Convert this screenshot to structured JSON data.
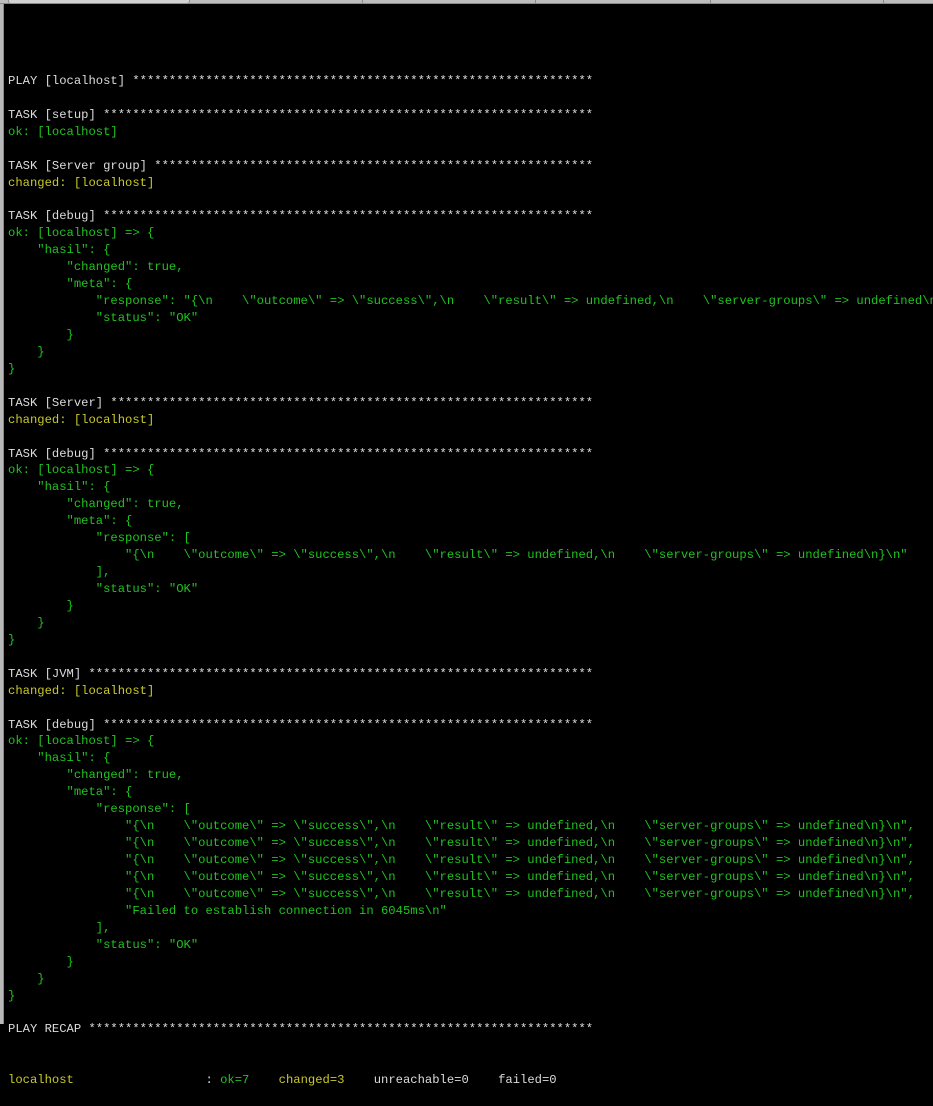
{
  "window": {
    "tabs": [
      {
        "label": "",
        "active": true
      },
      {
        "label": "",
        "active": false
      },
      {
        "label": "",
        "active": false
      },
      {
        "label": "",
        "active": false
      },
      {
        "label": "",
        "active": false
      }
    ]
  },
  "colors": {
    "background": "#000000",
    "header": "#dcdcdc",
    "ok": "#1fc41f",
    "changed": "#c9c92a"
  },
  "terminal": {
    "lines": [
      {
        "style": "white",
        "text": "PLAY [localhost] ***************************************************************"
      },
      {
        "style": "white",
        "text": ""
      },
      {
        "style": "white",
        "text": "TASK [setup] *******************************************************************"
      },
      {
        "style": "green",
        "text": "ok: [localhost]"
      },
      {
        "style": "white",
        "text": ""
      },
      {
        "style": "white",
        "text": "TASK [Server group] ************************************************************"
      },
      {
        "style": "yellow",
        "text": "changed: [localhost]"
      },
      {
        "style": "white",
        "text": ""
      },
      {
        "style": "white",
        "text": "TASK [debug] *******************************************************************"
      },
      {
        "style": "green",
        "text": "ok: [localhost] => {"
      },
      {
        "style": "green",
        "text": "    \"hasil\": {"
      },
      {
        "style": "green",
        "text": "        \"changed\": true,"
      },
      {
        "style": "green",
        "text": "        \"meta\": {"
      },
      {
        "style": "green",
        "text": "            \"response\": \"{\\n    \\\"outcome\\\" => \\\"success\\\",\\n    \\\"result\\\" => undefined,\\n    \\\"server-groups\\\" => undefined\\n}\\n\","
      },
      {
        "style": "green",
        "text": "            \"status\": \"OK\""
      },
      {
        "style": "green",
        "text": "        }"
      },
      {
        "style": "green",
        "text": "    }"
      },
      {
        "style": "green",
        "text": "}"
      },
      {
        "style": "white",
        "text": ""
      },
      {
        "style": "white",
        "text": "TASK [Server] ******************************************************************"
      },
      {
        "style": "yellow",
        "text": "changed: [localhost]"
      },
      {
        "style": "white",
        "text": ""
      },
      {
        "style": "white",
        "text": "TASK [debug] *******************************************************************"
      },
      {
        "style": "green",
        "text": "ok: [localhost] => {"
      },
      {
        "style": "green",
        "text": "    \"hasil\": {"
      },
      {
        "style": "green",
        "text": "        \"changed\": true,"
      },
      {
        "style": "green",
        "text": "        \"meta\": {"
      },
      {
        "style": "green",
        "text": "            \"response\": ["
      },
      {
        "style": "green",
        "text": "                \"{\\n    \\\"outcome\\\" => \\\"success\\\",\\n    \\\"result\\\" => undefined,\\n    \\\"server-groups\\\" => undefined\\n}\\n\""
      },
      {
        "style": "green",
        "text": "            ],"
      },
      {
        "style": "green",
        "text": "            \"status\": \"OK\""
      },
      {
        "style": "green",
        "text": "        }"
      },
      {
        "style": "green",
        "text": "    }"
      },
      {
        "style": "green",
        "text": "}"
      },
      {
        "style": "white",
        "text": ""
      },
      {
        "style": "white",
        "text": "TASK [JVM] *********************************************************************"
      },
      {
        "style": "yellow",
        "text": "changed: [localhost]"
      },
      {
        "style": "white",
        "text": ""
      },
      {
        "style": "white",
        "text": "TASK [debug] *******************************************************************"
      },
      {
        "style": "green",
        "text": "ok: [localhost] => {"
      },
      {
        "style": "green",
        "text": "    \"hasil\": {"
      },
      {
        "style": "green",
        "text": "        \"changed\": true,"
      },
      {
        "style": "green",
        "text": "        \"meta\": {"
      },
      {
        "style": "green",
        "text": "            \"response\": ["
      },
      {
        "style": "green",
        "text": "                \"{\\n    \\\"outcome\\\" => \\\"success\\\",\\n    \\\"result\\\" => undefined,\\n    \\\"server-groups\\\" => undefined\\n}\\n\","
      },
      {
        "style": "green",
        "text": "                \"{\\n    \\\"outcome\\\" => \\\"success\\\",\\n    \\\"result\\\" => undefined,\\n    \\\"server-groups\\\" => undefined\\n}\\n\","
      },
      {
        "style": "green",
        "text": "                \"{\\n    \\\"outcome\\\" => \\\"success\\\",\\n    \\\"result\\\" => undefined,\\n    \\\"server-groups\\\" => undefined\\n}\\n\","
      },
      {
        "style": "green",
        "text": "                \"{\\n    \\\"outcome\\\" => \\\"success\\\",\\n    \\\"result\\\" => undefined,\\n    \\\"server-groups\\\" => undefined\\n}\\n\","
      },
      {
        "style": "green",
        "text": "                \"{\\n    \\\"outcome\\\" => \\\"success\\\",\\n    \\\"result\\\" => undefined,\\n    \\\"server-groups\\\" => undefined\\n}\\n\","
      },
      {
        "style": "green",
        "text": "                \"Failed to establish connection in 6045ms\\n\""
      },
      {
        "style": "green",
        "text": "            ],"
      },
      {
        "style": "green",
        "text": "            \"status\": \"OK\""
      },
      {
        "style": "green",
        "text": "        }"
      },
      {
        "style": "green",
        "text": "    }"
      },
      {
        "style": "green",
        "text": "}"
      },
      {
        "style": "white",
        "text": ""
      },
      {
        "style": "white",
        "text": "PLAY RECAP *********************************************************************"
      }
    ],
    "recap": {
      "host": "localhost                 ",
      "sep": " : ",
      "ok": "ok=7",
      "gap1": "    ",
      "changed": "changed=3",
      "gap2": "    ",
      "unreachable": "unreachable=0",
      "gap3": "    ",
      "failed": "failed=0"
    }
  }
}
